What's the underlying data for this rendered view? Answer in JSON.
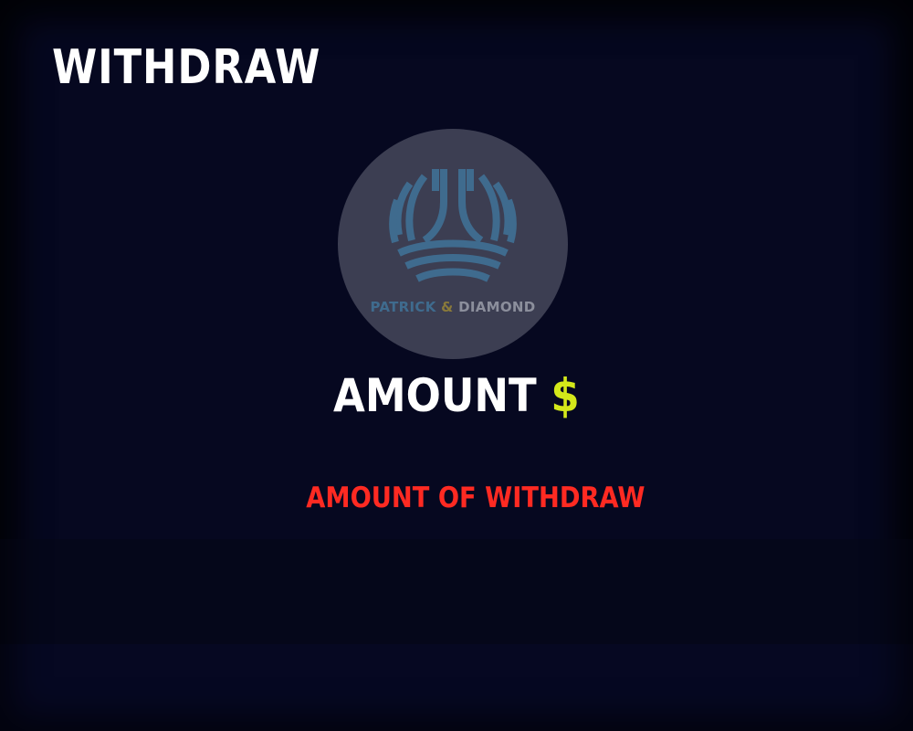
{
  "header": {
    "title": "WITHDRAW"
  },
  "logo": {
    "icon": "patrick-diamond-logo-icon",
    "text_part_1": "PATRICK",
    "text_amp": "&",
    "text_part_2": "DIAMOND",
    "colors": {
      "circle": "#3c3e52",
      "mark": "#3f6b8e",
      "amp": "#8a7a3a",
      "secondary_text": "#8c8f9c"
    }
  },
  "amount": {
    "label": "AMOUNT",
    "currency_symbol": "$",
    "currency_color": "#d4e81a"
  },
  "hint": {
    "text": "AMOUNT OF WITHDRAW",
    "color": "#ff2a22"
  },
  "colors": {
    "background": "#060820",
    "title": "#ffffff"
  }
}
